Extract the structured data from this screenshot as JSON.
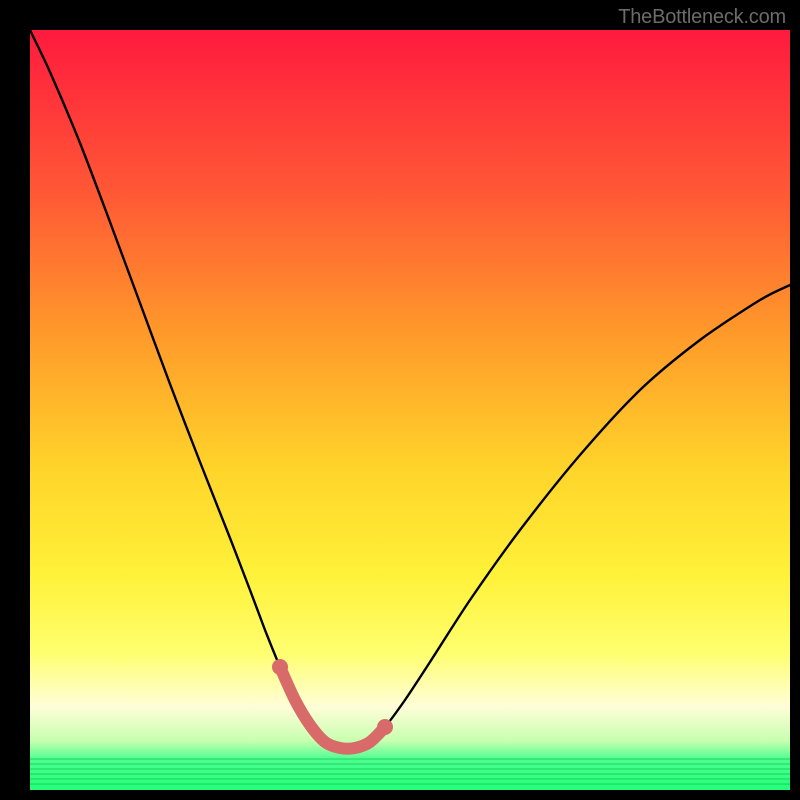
{
  "watermark": "TheBottleneck.com",
  "colors": {
    "page_bg": "#000000",
    "gradient_top": "#ff1a3e",
    "gradient_upper_mid": "#ff8a2a",
    "gradient_mid": "#ffe52a",
    "gradient_lower_mid": "#ffff66",
    "gradient_pale": "#fffde0",
    "gradient_green": "#24ff7a",
    "curve_stroke": "#000000",
    "highlight_stroke": "#d86a6a"
  },
  "chart_data": {
    "type": "line",
    "title": "",
    "xlabel": "",
    "ylabel": "",
    "series": [
      {
        "name": "bottleneck-curve",
        "x": [
          30,
          50,
          80,
          110,
          140,
          170,
          200,
          230,
          250,
          265,
          280,
          295,
          310,
          325,
          340,
          355,
          370,
          385,
          405,
          430,
          470,
          520,
          580,
          640,
          700,
          760,
          790
        ],
        "y": [
          30,
          72,
          143,
          222,
          303,
          384,
          462,
          538,
          590,
          630,
          667,
          700,
          725,
          742,
          748,
          748,
          742,
          727,
          700,
          662,
          600,
          530,
          455,
          390,
          340,
          300,
          285
        ],
        "color": "#000000"
      }
    ],
    "highlight_segment": {
      "name": "low-bottleneck-zone",
      "x": [
        280,
        295,
        310,
        325,
        340,
        355,
        370,
        385
      ],
      "y": [
        667,
        700,
        725,
        742,
        748,
        748,
        742,
        727
      ],
      "color": "#d86a6a"
    },
    "xlim": [
      30,
      790
    ],
    "ylim": [
      30,
      790
    ]
  }
}
